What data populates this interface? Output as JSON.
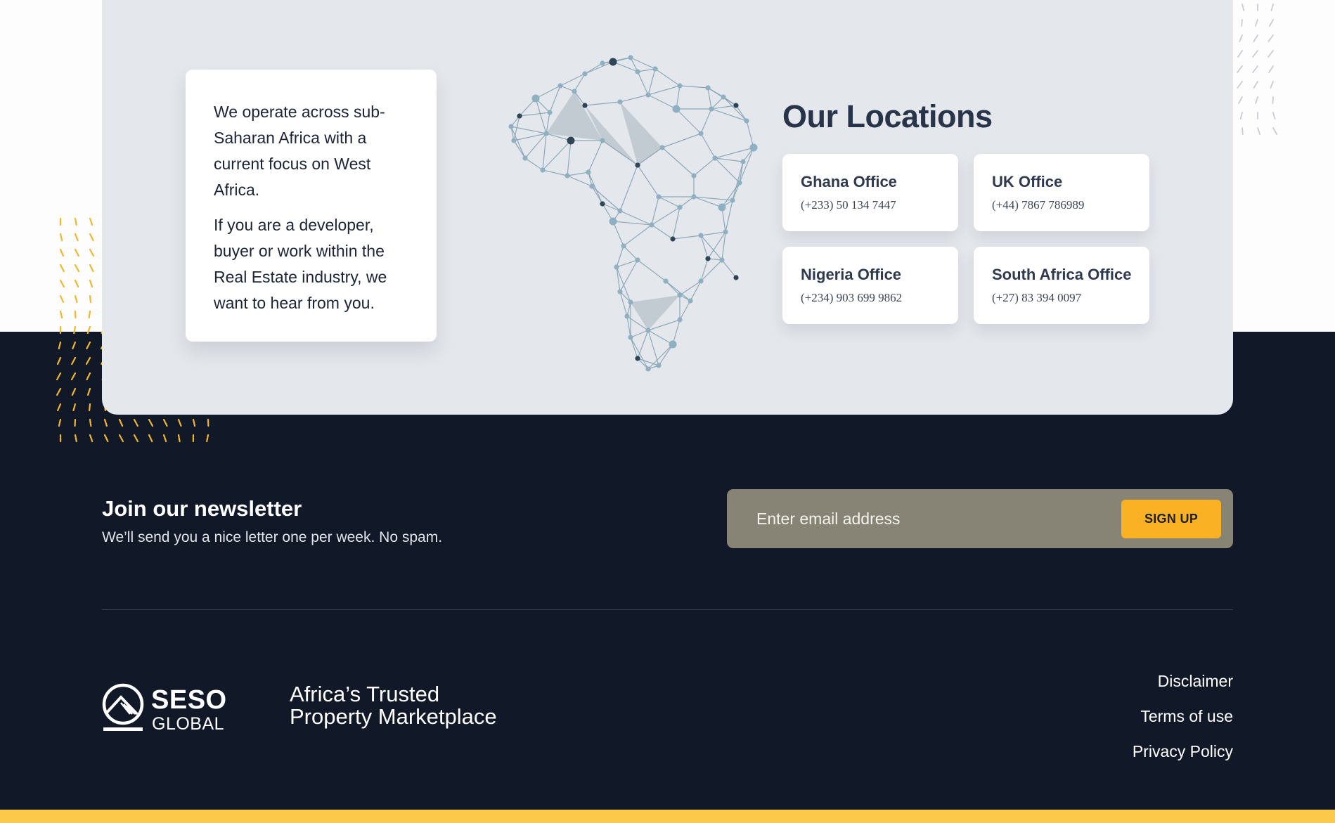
{
  "about": {
    "paragraph_1": "We operate across sub-Saharan Africa with a current focus on West Africa.",
    "paragraph_2": "If you are a developer, buyer or work within the Real Estate industry, we want to hear from you."
  },
  "locations": {
    "title": "Our Locations",
    "offices": [
      {
        "name": "Ghana Office",
        "phone": "(+233) 50 134 7447"
      },
      {
        "name": "UK Office",
        "phone": "(+44) 7867 786989"
      },
      {
        "name": "Nigeria Office",
        "phone": "(+234) 903 699 9862"
      },
      {
        "name": "South Africa Office",
        "phone": "(+27) 83 394 0097"
      }
    ]
  },
  "newsletter": {
    "title": "Join our newsletter",
    "subtitle": "We’ll send you a nice letter one per week. No spam.",
    "email_placeholder": "Enter email address",
    "signup_label": "SIGN UP"
  },
  "footer": {
    "logo_line_1": "SESO",
    "logo_line_2": "GLOBAL",
    "tagline_line_1": "Africa’s Trusted",
    "tagline_line_2": "Property Marketplace",
    "links": [
      "Disclaimer",
      "Terms of use",
      "Privacy Policy"
    ]
  },
  "colors": {
    "dark_background": "#111827",
    "accent_yellow": "#fbb124",
    "card_background": "#e4e7ec",
    "footer_stripe": "#fcc94a"
  },
  "icons": {
    "logo": "seso-global-logo-icon",
    "map": "africa-network-map"
  }
}
